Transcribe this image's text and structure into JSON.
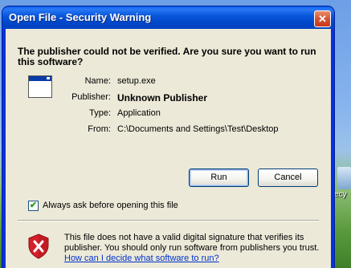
{
  "desktop": {
    "icon_label": "ecy"
  },
  "dialog": {
    "title": "Open File - Security Warning",
    "close_glyph": "✕",
    "headline": "The publisher could not be verified.  Are you sure you want to run this software?",
    "fields": [
      {
        "label": "Name:",
        "value": "setup.exe"
      },
      {
        "label": "Publisher:",
        "value": "Unknown Publisher"
      },
      {
        "label": "Type:",
        "value": "Application"
      },
      {
        "label": "From:",
        "value": "C:\\Documents and Settings\\Test\\Desktop"
      }
    ],
    "run_label": "Run",
    "cancel_label": "Cancel",
    "checkbox": {
      "label": "Always ask before opening this file",
      "checked": true,
      "glyph": "✔"
    },
    "warning": {
      "text": "This file does not have a valid digital signature that verifies its publisher.  You should only run software from publishers you trust.",
      "link": "How can I decide what software to run?"
    },
    "colors": {
      "title_blue": "#0a58dd",
      "close_red": "#d65533",
      "dialog_face": "#ece9d8",
      "shield_red": "#d4202a"
    },
    "icons": {
      "app": "window-app-icon",
      "shield": "shield-x-icon"
    }
  }
}
